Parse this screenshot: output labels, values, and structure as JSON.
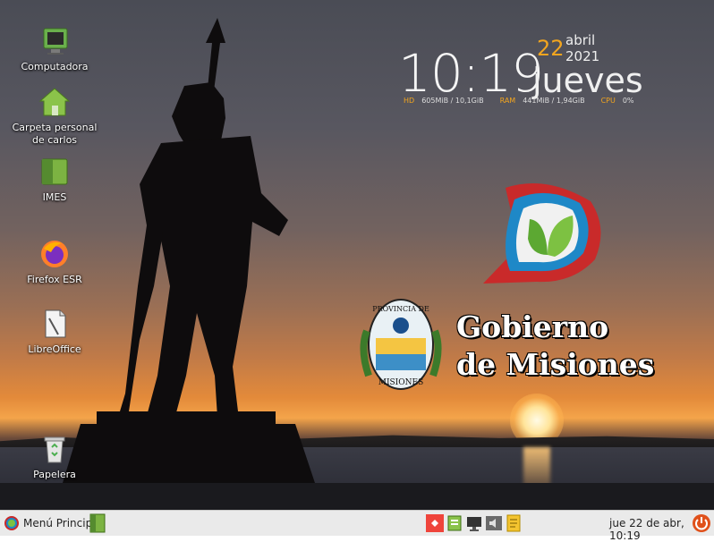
{
  "desktop": {
    "icons": [
      {
        "label": "Computadora",
        "icon": "monitor-icon"
      },
      {
        "label": "Carpeta personal de carlos",
        "icon": "home-folder-icon"
      },
      {
        "label": "IMES",
        "icon": "folder-icon"
      },
      {
        "label": "Firefox ESR",
        "icon": "firefox-icon"
      },
      {
        "label": "LibreOffice",
        "icon": "libreoffice-icon"
      },
      {
        "label": "Papelera",
        "icon": "trash-icon"
      }
    ]
  },
  "clock_widget": {
    "time": "10:19",
    "day": "22",
    "month_year": "abril 2021",
    "weekday": "jueves",
    "stats": {
      "hd_label": "HD",
      "hd_value": "605MiB / 10,1GiB",
      "ram_label": "RAM",
      "ram_value": "441MiB / 1,94GiB",
      "cpu_label": "CPU",
      "cpu_value": "0%"
    }
  },
  "wallpaper": {
    "title_line1": "Gobierno",
    "title_line2": "de Misiones",
    "seal_top": "PROVINCIA DE",
    "seal_bottom": "MISIONES"
  },
  "taskbar": {
    "menu_label": "Menú Principal",
    "clock": "jue 22 de abr, 10:19",
    "tray_icons": [
      "anydesk-icon",
      "network-icon",
      "display-icon",
      "volume-icon",
      "notes-icon"
    ]
  },
  "colors": {
    "accent": "#f2a51f",
    "taskbar_bg": "#eaeaea",
    "power": "#e0511b"
  }
}
